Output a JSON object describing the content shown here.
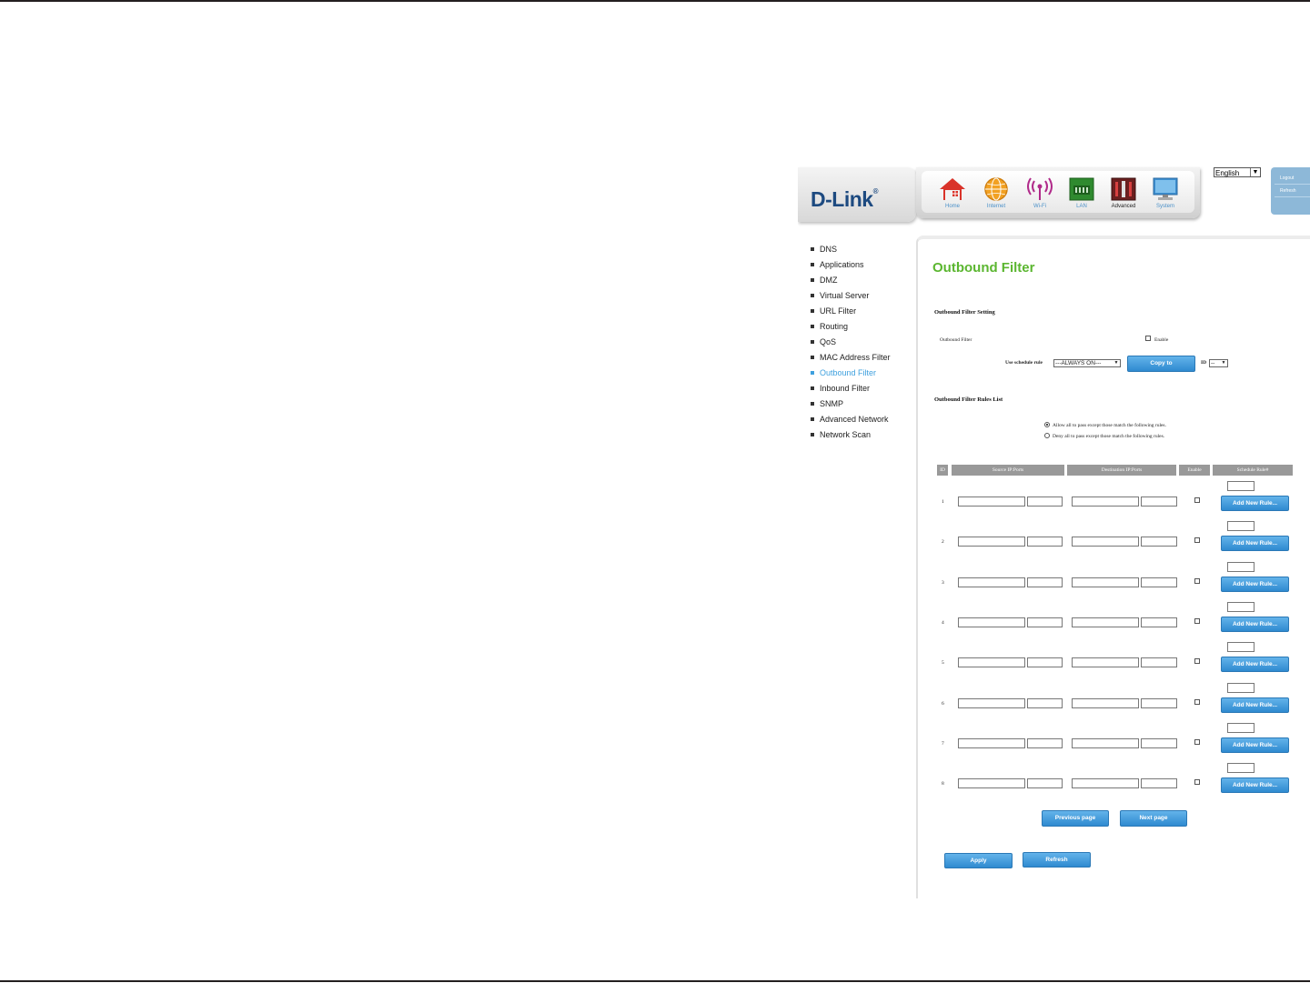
{
  "brand": {
    "logo": "D-Link",
    "reg": "®"
  },
  "nav": [
    {
      "label": "Home",
      "icon": "home-icon"
    },
    {
      "label": "Internet",
      "icon": "globe-icon"
    },
    {
      "label": "Wi-Fi",
      "icon": "wifi-icon"
    },
    {
      "label": "LAN",
      "icon": "lan-icon"
    },
    {
      "label": "Advanced",
      "icon": "advanced-tools-icon"
    },
    {
      "label": "System",
      "icon": "monitor-icon"
    }
  ],
  "language": {
    "selected": "English"
  },
  "session": {
    "logout": "Logout",
    "refresh": "Refresh"
  },
  "menu": [
    {
      "label": "DNS",
      "active": false
    },
    {
      "label": "Applications",
      "active": false
    },
    {
      "label": "DMZ",
      "active": false
    },
    {
      "label": "Virtual Server",
      "active": false
    },
    {
      "label": "URL Filter",
      "active": false
    },
    {
      "label": "Routing",
      "active": false
    },
    {
      "label": "QoS",
      "active": false
    },
    {
      "label": "MAC Address Filter",
      "active": false
    },
    {
      "label": "Outbound Filter",
      "active": true
    },
    {
      "label": "Inbound Filter",
      "active": false
    },
    {
      "label": "SNMP",
      "active": false
    },
    {
      "label": "Advanced Network",
      "active": false
    },
    {
      "label": "Network Scan",
      "active": false
    }
  ],
  "page": {
    "title": "Outbound Filter",
    "setting_title": "Outbound Filter Setting",
    "filter_label": "Outbound Filter",
    "enable_label": "Enable",
    "schedule_label": "Use schedule rule",
    "schedule_value": "---ALWAYS ON---",
    "copy_button": "Copy to",
    "id_label": "ID",
    "id_value": "--",
    "rules_title": "Outbound Filter Rules List",
    "radio_allow": "Allow all to pass except those match the following rules.",
    "radio_deny": "Deny all to pass except those match the following rules.",
    "columns": [
      "ID",
      "Source IP:Ports",
      "Destination IP:Ports",
      "Enable",
      "Schedule Rule#"
    ],
    "rows": [
      "1",
      "2",
      "3",
      "4",
      "5",
      "6",
      "7",
      "8"
    ],
    "add_rule_button": "Add New Rule...",
    "prev_button": "Previous page",
    "next_button": "Next page",
    "apply_button": "Apply",
    "refresh_button": "Refresh"
  },
  "colors": {
    "accent_blue": "#3ea0de",
    "title_green": "#5bb630",
    "header_gray": "#999999"
  }
}
